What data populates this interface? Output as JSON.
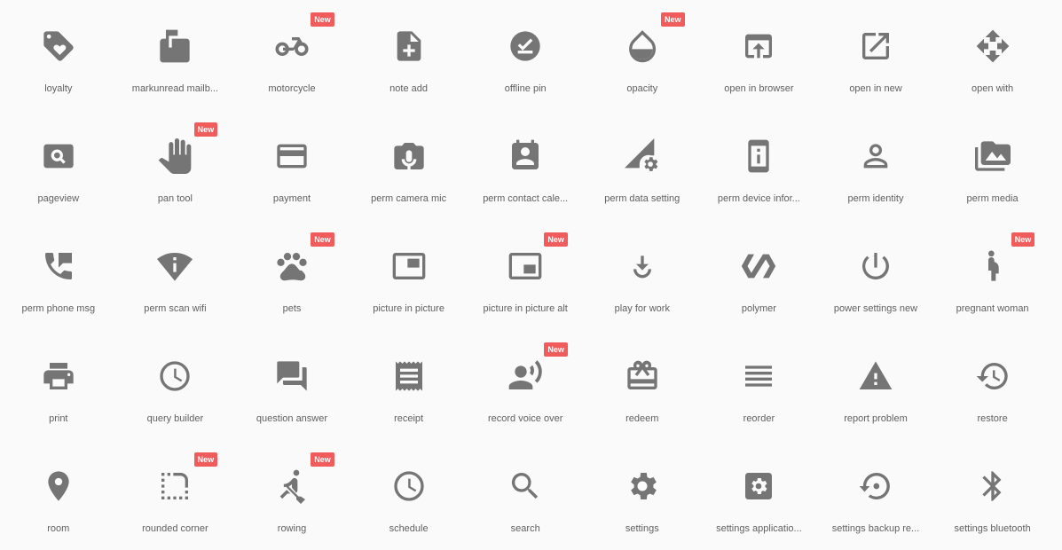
{
  "icon_color": "#757575",
  "badge_color": "#f05b5b",
  "badge_label": "New",
  "items": [
    {
      "label": "loyalty",
      "icon": "loyalty-icon",
      "new": false
    },
    {
      "label": "markunread mailb...",
      "icon": "mailbox-icon",
      "new": false
    },
    {
      "label": "motorcycle",
      "icon": "motorcycle-icon",
      "new": true
    },
    {
      "label": "note add",
      "icon": "note-add-icon",
      "new": false
    },
    {
      "label": "offline pin",
      "icon": "offline-pin-icon",
      "new": false
    },
    {
      "label": "opacity",
      "icon": "opacity-icon",
      "new": true
    },
    {
      "label": "open in browser",
      "icon": "open-in-browser-icon",
      "new": false
    },
    {
      "label": "open in new",
      "icon": "open-in-new-icon",
      "new": false
    },
    {
      "label": "open with",
      "icon": "open-with-icon",
      "new": false
    },
    {
      "label": "pageview",
      "icon": "pageview-icon",
      "new": false
    },
    {
      "label": "pan tool",
      "icon": "pan-tool-icon",
      "new": true
    },
    {
      "label": "payment",
      "icon": "payment-icon",
      "new": false
    },
    {
      "label": "perm camera mic",
      "icon": "camera-mic-icon",
      "new": false
    },
    {
      "label": "perm contact cale...",
      "icon": "contact-calendar-icon",
      "new": false
    },
    {
      "label": "perm data setting",
      "icon": "data-setting-icon",
      "new": false
    },
    {
      "label": "perm device infor...",
      "icon": "device-info-icon",
      "new": false
    },
    {
      "label": "perm identity",
      "icon": "identity-icon",
      "new": false
    },
    {
      "label": "perm media",
      "icon": "media-icon",
      "new": false
    },
    {
      "label": "perm phone msg",
      "icon": "phone-msg-icon",
      "new": false
    },
    {
      "label": "perm scan wifi",
      "icon": "scan-wifi-icon",
      "new": false
    },
    {
      "label": "pets",
      "icon": "pets-icon",
      "new": true
    },
    {
      "label": "picture in picture",
      "icon": "pip-icon",
      "new": false
    },
    {
      "label": "picture in picture alt",
      "icon": "pip-alt-icon",
      "new": true
    },
    {
      "label": "play for work",
      "icon": "play-for-work-icon",
      "new": false
    },
    {
      "label": "polymer",
      "icon": "polymer-icon",
      "new": false
    },
    {
      "label": "power settings new",
      "icon": "power-icon",
      "new": false
    },
    {
      "label": "pregnant woman",
      "icon": "pregnant-woman-icon",
      "new": true
    },
    {
      "label": "print",
      "icon": "print-icon",
      "new": false
    },
    {
      "label": "query builder",
      "icon": "clock-icon",
      "new": false
    },
    {
      "label": "question answer",
      "icon": "question-answer-icon",
      "new": false
    },
    {
      "label": "receipt",
      "icon": "receipt-icon",
      "new": false
    },
    {
      "label": "record voice over",
      "icon": "voice-over-icon",
      "new": true
    },
    {
      "label": "redeem",
      "icon": "redeem-icon",
      "new": false
    },
    {
      "label": "reorder",
      "icon": "reorder-icon",
      "new": false
    },
    {
      "label": "report problem",
      "icon": "warning-icon",
      "new": false
    },
    {
      "label": "restore",
      "icon": "restore-icon",
      "new": false
    },
    {
      "label": "room",
      "icon": "room-icon",
      "new": false
    },
    {
      "label": "rounded corner",
      "icon": "rounded-corner-icon",
      "new": true
    },
    {
      "label": "rowing",
      "icon": "rowing-icon",
      "new": true
    },
    {
      "label": "schedule",
      "icon": "clock-icon",
      "new": false
    },
    {
      "label": "search",
      "icon": "search-icon",
      "new": false
    },
    {
      "label": "settings",
      "icon": "settings-icon",
      "new": false
    },
    {
      "label": "settings applicatio...",
      "icon": "settings-applications-icon",
      "new": false
    },
    {
      "label": "settings backup re...",
      "icon": "settings-backup-restore-icon",
      "new": false
    },
    {
      "label": "settings bluetooth",
      "icon": "bluetooth-icon",
      "new": false
    }
  ]
}
